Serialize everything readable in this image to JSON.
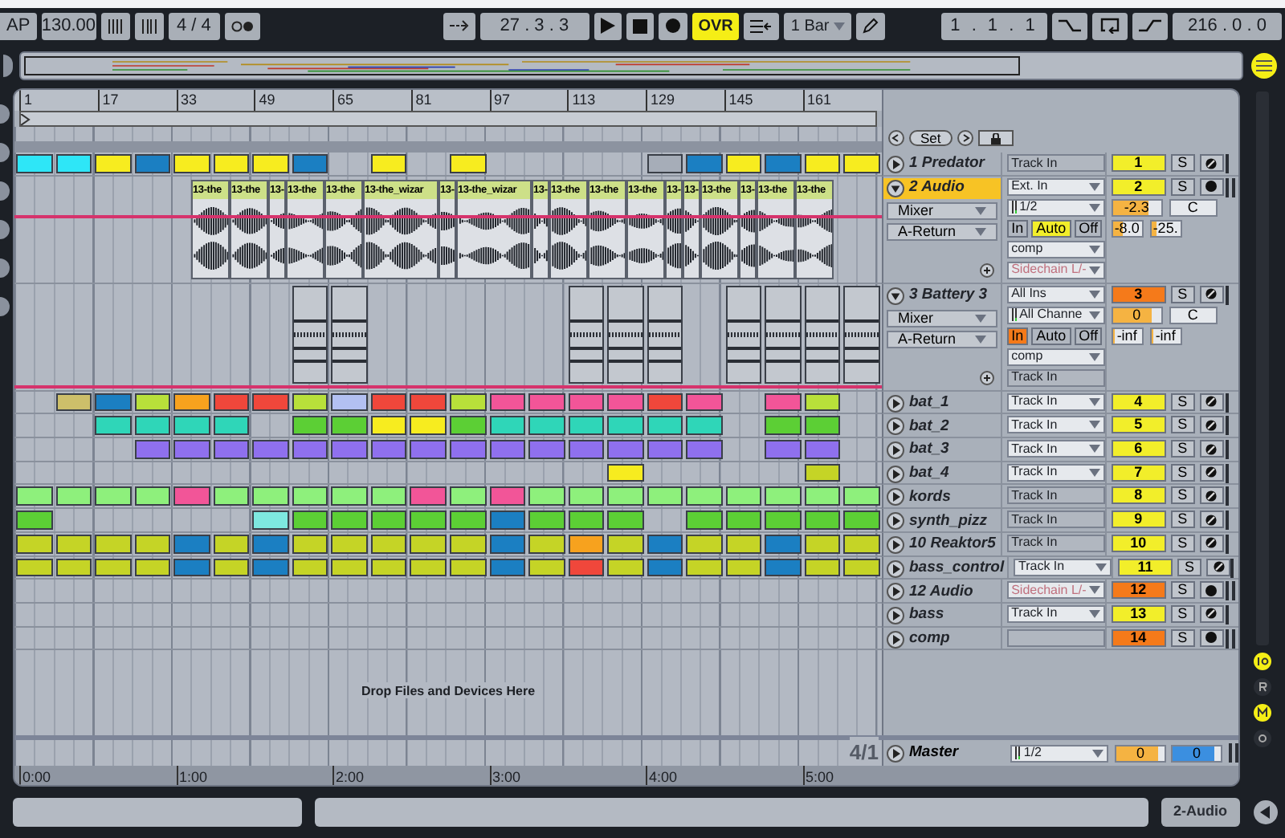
{
  "transport": {
    "tap": "AP",
    "tempo": "130.00",
    "signature": "4 / 4",
    "position": "27 . 3 . 3",
    "overdub": {
      "label": "OVR",
      "on": true
    },
    "quantize": "1 Bar",
    "loop_start": "1 . 1 . 1",
    "loop_length": "216 . 0 . 0"
  },
  "arrangement": {
    "set_button": "Set",
    "bar_ruler": [
      "1",
      "17",
      "33",
      "49",
      "65",
      "81",
      "97",
      "113",
      "129",
      "145",
      "161"
    ],
    "time_ruler": [
      "0:00",
      "1:00",
      "2:00",
      "3:00",
      "4:00",
      "5:00"
    ],
    "drop_hint": "Drop Files and Devices Here",
    "zoom_label": "4/1"
  },
  "tracks": [
    {
      "name": "1 Predator",
      "kind": "midi",
      "expanded": false,
      "selected": false,
      "color": "#f2ee2a",
      "number": "1",
      "solo": "S",
      "io": [
        {
          "kind": "field",
          "text": "Track In",
          "dropdown": false,
          "disabled": false
        }
      ],
      "clips": [
        {
          "kind": "clip",
          "color": "#2ee6f7"
        },
        {
          "kind": "clip",
          "color": "#2ee6f7"
        },
        {
          "kind": "clip",
          "color": "#f7ec1f"
        },
        {
          "kind": "clip",
          "color": "#1b7fc2"
        },
        {
          "kind": "clip",
          "color": "#f7ec1f"
        },
        {
          "kind": "clip",
          "color": "#f7ec1f"
        },
        {
          "kind": "clip",
          "color": "#f7ec1f"
        },
        {
          "kind": "clip",
          "color": "#1b7fc2"
        },
        {
          "kind": "gap"
        },
        {
          "kind": "clip",
          "color": "#f7ec1f"
        },
        {
          "kind": "gap"
        },
        {
          "kind": "clip",
          "color": "#f7ec1f"
        },
        {
          "kind": "gap"
        },
        {
          "kind": "gap"
        },
        {
          "kind": "gap"
        },
        {
          "kind": "gap"
        },
        {
          "kind": "clip",
          "color": "#a6adb8"
        },
        {
          "kind": "clip",
          "color": "#1b7fc2"
        },
        {
          "kind": "clip",
          "color": "#f7ec1f"
        },
        {
          "kind": "clip",
          "color": "#1b7fc2"
        },
        {
          "kind": "clip",
          "color": "#f7ec1f"
        },
        {
          "kind": "clip",
          "color": "#f7ec1f"
        }
      ]
    },
    {
      "name": "2 Audio",
      "kind": "audio",
      "expanded": true,
      "selected": true,
      "color": "#f2ee2a",
      "number": "2",
      "solo": "S",
      "routing": [
        "Mixer",
        "A-Return"
      ],
      "io": [
        {
          "kind": "field",
          "text": "Ext. In",
          "dropdown": true,
          "disabled": false
        },
        {
          "kind": "field",
          "text": "1/2",
          "dropdown": true,
          "disabled": false,
          "meter": true
        },
        {
          "kind": "monitor",
          "buttons": [
            {
              "label": "In",
              "selected": false
            },
            {
              "label": "Auto",
              "selected": true
            },
            {
              "label": "Off",
              "selected": false
            }
          ]
        },
        {
          "kind": "field",
          "text": "comp",
          "dropdown": true,
          "disabled": false
        },
        {
          "kind": "field",
          "text": "Sidechain L/-",
          "dropdown": true,
          "disabled": true
        }
      ],
      "volume": {
        "value": "-2.3",
        "level": 0.75
      },
      "pan": "C",
      "sends": [
        {
          "value": "-8.0",
          "level": 0.35
        },
        {
          "value": "-25.",
          "level": 0.2
        }
      ],
      "audio_clips": [
        {
          "label": "13-the",
          "kind": "medium"
        },
        {
          "label": "13-the",
          "kind": "medium"
        },
        {
          "label": "13-",
          "kind": "short"
        },
        {
          "label": "13-the",
          "kind": "medium"
        },
        {
          "label": "13-the",
          "kind": "medium"
        },
        {
          "label": "13-the_wizar",
          "kind": "long"
        },
        {
          "label": "13-",
          "kind": "short"
        },
        {
          "label": "13-the_wizar",
          "kind": "long"
        },
        {
          "label": "13-",
          "kind": "short"
        },
        {
          "label": "13-the",
          "kind": "medium"
        },
        {
          "label": "13-the",
          "kind": "medium"
        },
        {
          "label": "13-the",
          "kind": "medium"
        },
        {
          "label": "13-",
          "kind": "short"
        },
        {
          "label": "13-",
          "kind": "short"
        },
        {
          "label": "13-the",
          "kind": "medium"
        },
        {
          "label": "13-",
          "kind": "short"
        },
        {
          "label": "13-the",
          "kind": "medium"
        },
        {
          "label": "13-the",
          "kind": "medium"
        }
      ]
    },
    {
      "name": "3 Battery 3",
      "kind": "midi",
      "expanded": true,
      "selected": false,
      "color": "#f57a1a",
      "number": "3",
      "solo": "S",
      "routing": [
        "Mixer",
        "A-Return"
      ],
      "io": [
        {
          "kind": "field",
          "text": "All Ins",
          "dropdown": true,
          "disabled": false
        },
        {
          "kind": "field",
          "text": "All Channe",
          "dropdown": true,
          "disabled": false,
          "meter": true
        },
        {
          "kind": "monitor",
          "buttons": [
            {
              "label": "In",
              "selected": true
            },
            {
              "label": "Auto",
              "selected": false
            },
            {
              "label": "Off",
              "selected": false
            }
          ]
        },
        {
          "kind": "field",
          "text": "comp",
          "dropdown": true,
          "disabled": false
        },
        {
          "kind": "field",
          "text": "Track In",
          "dropdown": false,
          "disabled": false
        }
      ],
      "volume": {
        "value": "0",
        "level": 0.8
      },
      "pan": "C",
      "sends": [
        {
          "value": "-inf",
          "level": 0
        },
        {
          "value": "-inf",
          "level": 0
        }
      ],
      "clips": [
        {
          "kind": "gap"
        },
        {
          "kind": "gap"
        },
        {
          "kind": "gap"
        },
        {
          "kind": "gap"
        },
        {
          "kind": "gap"
        },
        {
          "kind": "gap"
        },
        {
          "kind": "gap"
        },
        {
          "kind": "clip",
          "color": "#c3c8cf"
        },
        {
          "kind": "clip",
          "color": "#c3c8cf"
        },
        {
          "kind": "gap"
        },
        {
          "kind": "gap"
        },
        {
          "kind": "gap"
        },
        {
          "kind": "gap"
        },
        {
          "kind": "gap"
        },
        {
          "kind": "clip",
          "color": "#c3c8cf"
        },
        {
          "kind": "clip",
          "color": "#c3c8cf"
        },
        {
          "kind": "clip",
          "color": "#c3c8cf"
        },
        {
          "kind": "gap"
        },
        {
          "kind": "clip",
          "color": "#c3c8cf"
        },
        {
          "kind": "clip",
          "color": "#c3c8cf"
        },
        {
          "kind": "clip",
          "color": "#c3c8cf"
        },
        {
          "kind": "clip",
          "color": "#c3c8cf"
        }
      ]
    },
    {
      "name": "bat_1",
      "kind": "midi",
      "expanded": false,
      "selected": false,
      "color": "#f2ee2a",
      "number": "4",
      "solo": "S",
      "io": [
        {
          "kind": "field",
          "text": "Track In",
          "dropdown": true,
          "disabled": false
        }
      ],
      "clips": [
        {
          "kind": "gap"
        },
        {
          "kind": "clip",
          "color": "#cdbf6a"
        },
        {
          "kind": "clip",
          "color": "#1b7fc2"
        },
        {
          "kind": "clip",
          "color": "#b8e03a"
        },
        {
          "kind": "clip",
          "color": "#f7a21e"
        },
        {
          "kind": "clip",
          "color": "#f0473b"
        },
        {
          "kind": "clip",
          "color": "#f0473b"
        },
        {
          "kind": "clip",
          "color": "#b8e03a"
        },
        {
          "kind": "clip",
          "color": "#b3c0f2"
        },
        {
          "kind": "clip",
          "color": "#f0473b"
        },
        {
          "kind": "clip",
          "color": "#f0473b"
        },
        {
          "kind": "clip",
          "color": "#b8e03a"
        },
        {
          "kind": "clip",
          "color": "#f25598"
        },
        {
          "kind": "clip",
          "color": "#f25598"
        },
        {
          "kind": "clip",
          "color": "#f25598"
        },
        {
          "kind": "clip",
          "color": "#f25598"
        },
        {
          "kind": "clip",
          "color": "#f0473b"
        },
        {
          "kind": "clip",
          "color": "#f25598"
        },
        {
          "kind": "gap"
        },
        {
          "kind": "clip",
          "color": "#f25598"
        },
        {
          "kind": "clip",
          "color": "#b8e03a"
        },
        {
          "kind": "gap"
        }
      ]
    },
    {
      "name": "bat_2",
      "kind": "midi",
      "expanded": false,
      "selected": false,
      "color": "#f2ee2a",
      "number": "5",
      "solo": "S",
      "io": [
        {
          "kind": "field",
          "text": "Track In",
          "dropdown": true,
          "disabled": false
        }
      ],
      "clips": [
        {
          "kind": "gap"
        },
        {
          "kind": "gap"
        },
        {
          "kind": "clip",
          "color": "#2fd6b8"
        },
        {
          "kind": "clip",
          "color": "#2fd6b8"
        },
        {
          "kind": "clip",
          "color": "#2fd6b8"
        },
        {
          "kind": "clip",
          "color": "#2fd6b8"
        },
        {
          "kind": "gap"
        },
        {
          "kind": "clip",
          "color": "#5ccf35"
        },
        {
          "kind": "clip",
          "color": "#5ccf35"
        },
        {
          "kind": "clip",
          "color": "#f7ec1f"
        },
        {
          "kind": "clip",
          "color": "#f7ec1f"
        },
        {
          "kind": "clip",
          "color": "#5ccf35"
        },
        {
          "kind": "clip",
          "color": "#2fd6b8"
        },
        {
          "kind": "clip",
          "color": "#2fd6b8"
        },
        {
          "kind": "clip",
          "color": "#2fd6b8"
        },
        {
          "kind": "clip",
          "color": "#2fd6b8"
        },
        {
          "kind": "clip",
          "color": "#2fd6b8"
        },
        {
          "kind": "clip",
          "color": "#2fd6b8"
        },
        {
          "kind": "gap"
        },
        {
          "kind": "clip",
          "color": "#5ccf35"
        },
        {
          "kind": "clip",
          "color": "#5ccf35"
        },
        {
          "kind": "gap"
        }
      ]
    },
    {
      "name": "bat_3",
      "kind": "midi",
      "expanded": false,
      "selected": false,
      "color": "#f2ee2a",
      "number": "6",
      "solo": "S",
      "io": [
        {
          "kind": "field",
          "text": "Track In",
          "dropdown": true,
          "disabled": false
        }
      ],
      "clips": [
        {
          "kind": "gap"
        },
        {
          "kind": "gap"
        },
        {
          "kind": "gap"
        },
        {
          "kind": "clip",
          "color": "#8f70ee"
        },
        {
          "kind": "clip",
          "color": "#8f70ee"
        },
        {
          "kind": "clip",
          "color": "#8f70ee"
        },
        {
          "kind": "clip",
          "color": "#8f70ee"
        },
        {
          "kind": "clip",
          "color": "#8f70ee"
        },
        {
          "kind": "clip",
          "color": "#8f70ee"
        },
        {
          "kind": "clip",
          "color": "#8f70ee"
        },
        {
          "kind": "clip",
          "color": "#8f70ee"
        },
        {
          "kind": "clip",
          "color": "#8f70ee"
        },
        {
          "kind": "clip",
          "color": "#8f70ee"
        },
        {
          "kind": "clip",
          "color": "#8f70ee"
        },
        {
          "kind": "clip",
          "color": "#8f70ee"
        },
        {
          "kind": "clip",
          "color": "#8f70ee"
        },
        {
          "kind": "clip",
          "color": "#8f70ee"
        },
        {
          "kind": "clip",
          "color": "#8f70ee"
        },
        {
          "kind": "gap"
        },
        {
          "kind": "clip",
          "color": "#8f70ee"
        },
        {
          "kind": "clip",
          "color": "#8f70ee"
        },
        {
          "kind": "gap"
        }
      ]
    },
    {
      "name": "bat_4",
      "kind": "midi",
      "expanded": false,
      "selected": false,
      "color": "#f2ee2a",
      "number": "7",
      "solo": "S",
      "io": [
        {
          "kind": "field",
          "text": "Track In",
          "dropdown": true,
          "disabled": false
        }
      ],
      "clips": [
        {
          "kind": "gap"
        },
        {
          "kind": "gap"
        },
        {
          "kind": "gap"
        },
        {
          "kind": "gap"
        },
        {
          "kind": "gap"
        },
        {
          "kind": "gap"
        },
        {
          "kind": "gap"
        },
        {
          "kind": "gap"
        },
        {
          "kind": "gap"
        },
        {
          "kind": "gap"
        },
        {
          "kind": "gap"
        },
        {
          "kind": "gap"
        },
        {
          "kind": "gap"
        },
        {
          "kind": "gap"
        },
        {
          "kind": "gap"
        },
        {
          "kind": "clip",
          "color": "#f7ec1f"
        },
        {
          "kind": "gap"
        },
        {
          "kind": "gap"
        },
        {
          "kind": "gap"
        },
        {
          "kind": "gap"
        },
        {
          "kind": "clip",
          "color": "#c5d426"
        },
        {
          "kind": "gap"
        }
      ]
    },
    {
      "name": "kords",
      "kind": "midi",
      "expanded": false,
      "selected": false,
      "color": "#f2ee2a",
      "number": "8",
      "solo": "S",
      "io": [
        {
          "kind": "field",
          "text": "Track In",
          "dropdown": false,
          "disabled": false
        }
      ],
      "clips": [
        {
          "kind": "clip",
          "color": "#8ef07c"
        },
        {
          "kind": "clip",
          "color": "#8ef07c"
        },
        {
          "kind": "clip",
          "color": "#8ef07c"
        },
        {
          "kind": "clip",
          "color": "#8ef07c"
        },
        {
          "kind": "clip",
          "color": "#f25598"
        },
        {
          "kind": "clip",
          "color": "#8ef07c"
        },
        {
          "kind": "clip",
          "color": "#8ef07c"
        },
        {
          "kind": "clip",
          "color": "#8ef07c"
        },
        {
          "kind": "clip",
          "color": "#8ef07c"
        },
        {
          "kind": "clip",
          "color": "#8ef07c"
        },
        {
          "kind": "clip",
          "color": "#f25598"
        },
        {
          "kind": "clip",
          "color": "#8ef07c"
        },
        {
          "kind": "clip",
          "color": "#f25598"
        },
        {
          "kind": "clip",
          "color": "#8ef07c"
        },
        {
          "kind": "clip",
          "color": "#8ef07c"
        },
        {
          "kind": "clip",
          "color": "#8ef07c"
        },
        {
          "kind": "clip",
          "color": "#8ef07c"
        },
        {
          "kind": "clip",
          "color": "#8ef07c"
        },
        {
          "kind": "clip",
          "color": "#8ef07c"
        },
        {
          "kind": "clip",
          "color": "#8ef07c"
        },
        {
          "kind": "clip",
          "color": "#8ef07c"
        },
        {
          "kind": "clip",
          "color": "#8ef07c"
        }
      ]
    },
    {
      "name": "synth_pizz",
      "kind": "midi",
      "expanded": false,
      "selected": false,
      "color": "#f2ee2a",
      "number": "9",
      "solo": "S",
      "io": [
        {
          "kind": "field",
          "text": "Track In",
          "dropdown": false,
          "disabled": false
        }
      ],
      "clips": [
        {
          "kind": "clip",
          "color": "#5ccf35"
        },
        {
          "kind": "gap"
        },
        {
          "kind": "gap"
        },
        {
          "kind": "gap"
        },
        {
          "kind": "gap"
        },
        {
          "kind": "gap"
        },
        {
          "kind": "clip",
          "color": "#7ee8e0"
        },
        {
          "kind": "clip",
          "color": "#5ccf35"
        },
        {
          "kind": "clip",
          "color": "#5ccf35"
        },
        {
          "kind": "clip",
          "color": "#5ccf35"
        },
        {
          "kind": "clip",
          "color": "#5ccf35"
        },
        {
          "kind": "clip",
          "color": "#5ccf35"
        },
        {
          "kind": "clip",
          "color": "#1b7fc2"
        },
        {
          "kind": "clip",
          "color": "#5ccf35"
        },
        {
          "kind": "clip",
          "color": "#5ccf35"
        },
        {
          "kind": "clip",
          "color": "#5ccf35"
        },
        {
          "kind": "gap"
        },
        {
          "kind": "clip",
          "color": "#5ccf35"
        },
        {
          "kind": "clip",
          "color": "#5ccf35"
        },
        {
          "kind": "clip",
          "color": "#5ccf35"
        },
        {
          "kind": "clip",
          "color": "#5ccf35"
        },
        {
          "kind": "clip",
          "color": "#5ccf35"
        }
      ]
    },
    {
      "name": "10 Reaktor5",
      "kind": "midi",
      "expanded": false,
      "selected": false,
      "color": "#f2ee2a",
      "number": "10",
      "solo": "S",
      "io": [
        {
          "kind": "field",
          "text": "Track In",
          "dropdown": false,
          "disabled": false
        }
      ],
      "clips": [
        {
          "kind": "clip",
          "color": "#c5d426"
        },
        {
          "kind": "clip",
          "color": "#c5d426"
        },
        {
          "kind": "clip",
          "color": "#c5d426"
        },
        {
          "kind": "clip",
          "color": "#c5d426"
        },
        {
          "kind": "clip",
          "color": "#1b7fc2"
        },
        {
          "kind": "clip",
          "color": "#c5d426"
        },
        {
          "kind": "clip",
          "color": "#1b7fc2"
        },
        {
          "kind": "clip",
          "color": "#c5d426"
        },
        {
          "kind": "clip",
          "color": "#c5d426"
        },
        {
          "kind": "clip",
          "color": "#c5d426"
        },
        {
          "kind": "clip",
          "color": "#c5d426"
        },
        {
          "kind": "clip",
          "color": "#c5d426"
        },
        {
          "kind": "clip",
          "color": "#1b7fc2"
        },
        {
          "kind": "clip",
          "color": "#c5d426"
        },
        {
          "kind": "clip",
          "color": "#f7a21e"
        },
        {
          "kind": "clip",
          "color": "#c5d426"
        },
        {
          "kind": "clip",
          "color": "#1b7fc2"
        },
        {
          "kind": "clip",
          "color": "#c5d426"
        },
        {
          "kind": "clip",
          "color": "#c5d426"
        },
        {
          "kind": "clip",
          "color": "#1b7fc2"
        },
        {
          "kind": "clip",
          "color": "#c5d426"
        },
        {
          "kind": "clip",
          "color": "#c5d426"
        }
      ]
    },
    {
      "name": "bass_control",
      "kind": "midi",
      "expanded": false,
      "selected": false,
      "color": "#f2ee2a",
      "number": "11",
      "solo": "S",
      "io": [
        {
          "kind": "field",
          "text": "Track In",
          "dropdown": true,
          "disabled": false
        }
      ],
      "clips": [
        {
          "kind": "clip",
          "color": "#c5d426"
        },
        {
          "kind": "clip",
          "color": "#c5d426"
        },
        {
          "kind": "clip",
          "color": "#c5d426"
        },
        {
          "kind": "clip",
          "color": "#c5d426"
        },
        {
          "kind": "clip",
          "color": "#1b7fc2"
        },
        {
          "kind": "clip",
          "color": "#c5d426"
        },
        {
          "kind": "clip",
          "color": "#1b7fc2"
        },
        {
          "kind": "clip",
          "color": "#c5d426"
        },
        {
          "kind": "clip",
          "color": "#c5d426"
        },
        {
          "kind": "clip",
          "color": "#c5d426"
        },
        {
          "kind": "clip",
          "color": "#c5d426"
        },
        {
          "kind": "clip",
          "color": "#c5d426"
        },
        {
          "kind": "clip",
          "color": "#1b7fc2"
        },
        {
          "kind": "clip",
          "color": "#c5d426"
        },
        {
          "kind": "clip",
          "color": "#f0473b"
        },
        {
          "kind": "clip",
          "color": "#c5d426"
        },
        {
          "kind": "clip",
          "color": "#1b7fc2"
        },
        {
          "kind": "clip",
          "color": "#c5d426"
        },
        {
          "kind": "clip",
          "color": "#c5d426"
        },
        {
          "kind": "clip",
          "color": "#1b7fc2"
        },
        {
          "kind": "clip",
          "color": "#c5d426"
        },
        {
          "kind": "clip",
          "color": "#c5d426"
        }
      ]
    },
    {
      "name": "12 Audio",
      "kind": "audio",
      "expanded": false,
      "selected": false,
      "color": "#f57a1a",
      "number": "12",
      "solo": "S",
      "io": [
        {
          "kind": "field",
          "text": "Sidechain L/-",
          "dropdown": true,
          "disabled": true
        }
      ]
    },
    {
      "name": "bass",
      "kind": "midi",
      "expanded": false,
      "selected": false,
      "color": "#f2ee2a",
      "number": "13",
      "solo": "S",
      "io": [
        {
          "kind": "field",
          "text": "Track In",
          "dropdown": true,
          "disabled": false
        }
      ]
    },
    {
      "name": "comp",
      "kind": "audio",
      "expanded": false,
      "selected": false,
      "color": "#f57a1a",
      "number": "14",
      "solo": "S",
      "io": [
        {
          "kind": "field",
          "dropdown": false
        }
      ]
    }
  ],
  "master": {
    "name": "Master",
    "output": {
      "text": "1/2",
      "dropdown": true,
      "disabled": false,
      "meter": true
    },
    "volume": {
      "value": "0",
      "level": 0.85
    },
    "cue": {
      "value": "0",
      "level": 0.85
    }
  },
  "status_bar": {
    "selected_track": "2-Audio"
  }
}
